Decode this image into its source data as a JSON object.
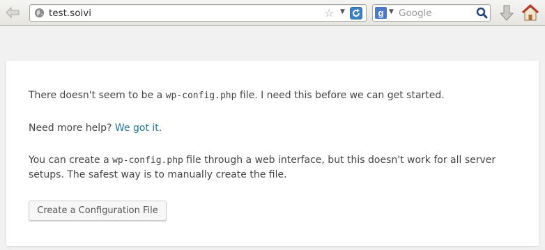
{
  "browser": {
    "url": "test.soivi",
    "search_placeholder": "Google",
    "search_engine_letter": "g",
    "icons": [
      "back-arrow-icon",
      "globe-icon",
      "star-icon",
      "dropdown-icon",
      "reload-icon",
      "google-icon",
      "magnifier-icon",
      "download-icon",
      "home-icon"
    ]
  },
  "page": {
    "p1_before": "There doesn't seem to be a ",
    "p1_code": "wp-config.php",
    "p1_after": " file. I need this before we can get started.",
    "p2_before": "Need more help? ",
    "p2_link": "We got it",
    "p2_after": ".",
    "p3_before": "You can create a ",
    "p3_code": "wp-config.php",
    "p3_after": " file through a web interface, but this doesn't work for all server setups. The safest way is to manually create the file.",
    "button_label": "Create a Configuration File",
    "link_color": "#21759b"
  }
}
